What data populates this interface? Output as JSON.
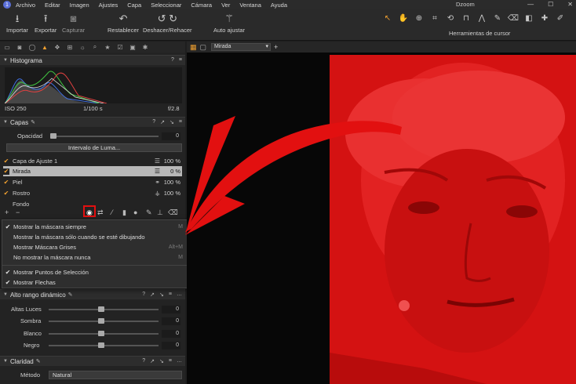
{
  "app": {
    "logo": "1",
    "title": "Dzoom"
  },
  "menu": [
    "Archivo",
    "Editar",
    "Imagen",
    "Ajustes",
    "Capa",
    "Seleccionar",
    "Cámara",
    "Ver",
    "Ventana",
    "Ayuda"
  ],
  "window_controls": {
    "minimize": "—",
    "maximize": "☐",
    "close": "✕"
  },
  "toolbar": {
    "buttons": [
      {
        "label": "Importar",
        "icon": "import-icon"
      },
      {
        "label": "Exportar",
        "icon": "export-icon"
      },
      {
        "label": "Capturar",
        "icon": "camera-icon"
      },
      {
        "label": "Restablecer",
        "icon": "reset-icon"
      },
      {
        "label": "Deshacer/Rehacer",
        "icon": "undo-redo-icon"
      },
      {
        "label": "Auto ajustar",
        "icon": "magic-wand-icon"
      }
    ],
    "cursor_tools_label": "Herramientas de cursor"
  },
  "viewer": {
    "view_select": "Mirada"
  },
  "histogram": {
    "title": "Histograma",
    "iso": "ISO 250",
    "shutter": "1/100 s",
    "aperture": "f/2.8"
  },
  "layers": {
    "title": "Capas",
    "opacity_label": "Opacidad",
    "opacity_value": "0",
    "luma_button": "Intervalo de Luma...",
    "items": [
      {
        "name": "Capa de Ajuste 1",
        "opacity": "100 %",
        "checked": true,
        "selected": false
      },
      {
        "name": "Mirada",
        "opacity": "0 %",
        "checked": true,
        "selected": true
      },
      {
        "name": "Piel",
        "opacity": "100 %",
        "checked": true,
        "selected": false
      },
      {
        "name": "Rostro",
        "opacity": "100 %",
        "checked": true,
        "selected": false
      },
      {
        "name": "Fondo",
        "opacity": "",
        "checked": false,
        "selected": false
      }
    ]
  },
  "mask_menu": {
    "items": [
      {
        "label": "Mostrar la máscara siempre",
        "shortcut": "M",
        "checked": true
      },
      {
        "label": "Mostrar la máscara sólo cuando se esté dibujando",
        "shortcut": "",
        "checked": false
      },
      {
        "label": "Mostrar Máscara Grises",
        "shortcut": "Alt+M",
        "checked": false
      },
      {
        "label": "No mostrar la máscara nunca",
        "shortcut": "M",
        "checked": false
      },
      {
        "label": "Mostrar Puntos de Selección",
        "shortcut": "",
        "checked": true
      },
      {
        "label": "Mostrar Flechas",
        "shortcut": "",
        "checked": true
      }
    ]
  },
  "hdr": {
    "title": "Alto rango dinámico",
    "sliders": [
      {
        "label": "Altas Luces",
        "value": "0"
      },
      {
        "label": "Sombra",
        "value": "0"
      },
      {
        "label": "Blanco",
        "value": "0"
      },
      {
        "label": "Negro",
        "value": "0"
      }
    ]
  },
  "clarity": {
    "title": "Claridad",
    "method_label": "Método",
    "method_value": "Natural"
  },
  "colors": {
    "accent": "#f0a030",
    "mask_red": "#d61414",
    "annotation_red": "#e21010"
  }
}
